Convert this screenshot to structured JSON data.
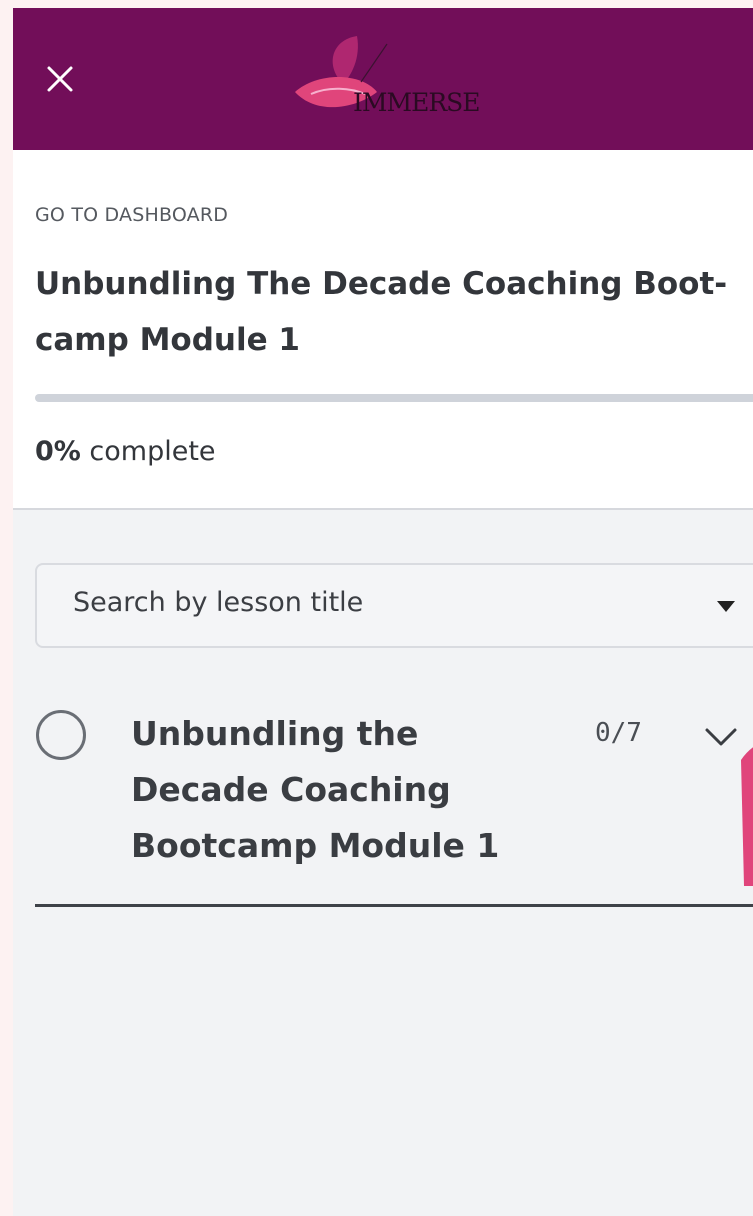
{
  "app": {
    "logo_text": "IMMERSE",
    "brand_color": "#720e59",
    "accent_color": "#e0457b"
  },
  "header": {
    "close_icon": "close-icon",
    "goto_label": "GO TO DASHBOARD",
    "course_title": "Unbundling The Decade Coaching Boot-camp Module 1",
    "progress": {
      "percent": 0,
      "percent_label": "0%",
      "suffix": " complete"
    }
  },
  "search": {
    "placeholder": "Search by lesson title",
    "dropdown_icon": "caret-down-icon"
  },
  "modules": [
    {
      "title": "Unbundling the Decade Coaching Bootcamp Module 1",
      "count": "0/7",
      "status_icon": "circle-incomplete-icon",
      "expand_icon": "chevron-down-icon"
    }
  ]
}
